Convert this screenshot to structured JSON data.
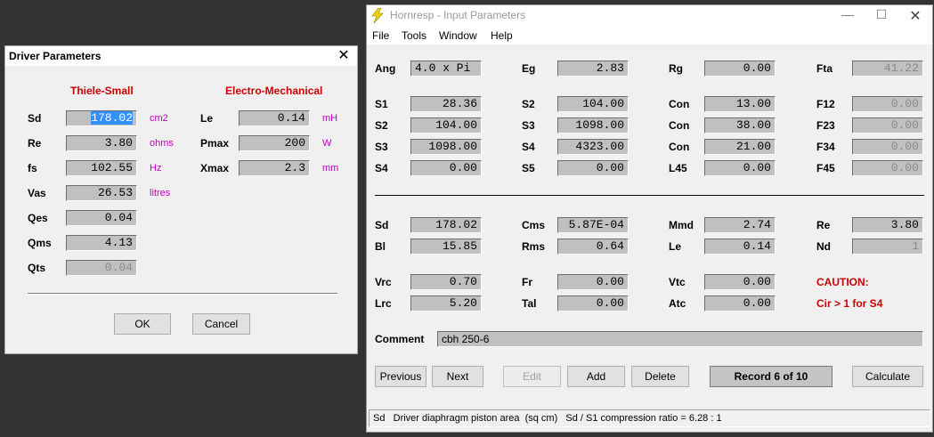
{
  "driver": {
    "title": "Driver Parameters",
    "close": "✕",
    "heading_ts": "Thiele-Small",
    "heading_em": "Electro-Mechanical",
    "ts": [
      {
        "label": "Sd",
        "value": "178.02",
        "unit": "cm2"
      },
      {
        "label": "Re",
        "value": "3.80",
        "unit": "ohms"
      },
      {
        "label": "fs",
        "value": "102.55",
        "unit": "Hz"
      },
      {
        "label": "Vas",
        "value": "26.53",
        "unit": "litres"
      },
      {
        "label": "Qes",
        "value": "0.04",
        "unit": ""
      },
      {
        "label": "Qms",
        "value": "4.13",
        "unit": ""
      },
      {
        "label": "Qts",
        "value": "0.04",
        "unit": ""
      }
    ],
    "em": [
      {
        "label": "Le",
        "value": "0.14",
        "unit": "mH"
      },
      {
        "label": "Pmax",
        "value": "200",
        "unit": "W"
      },
      {
        "label": "Xmax",
        "value": "2.3",
        "unit": "mm"
      }
    ],
    "ok": "OK",
    "cancel": "Cancel"
  },
  "input": {
    "title": "Hornresp - Input Parameters",
    "menu": [
      "File",
      "Tools",
      "Window",
      "Help"
    ],
    "ang": {
      "label": "Ang",
      "value": "4.0 x Pi"
    },
    "eg": {
      "label": "Eg",
      "value": "2.83"
    },
    "rg": {
      "label": "Rg",
      "value": "0.00"
    },
    "fta": {
      "label": "Fta",
      "value": "41.22"
    },
    "s1": {
      "label": "S1",
      "value": "28.36"
    },
    "s2a": {
      "label": "S2",
      "value": "104.00"
    },
    "con1": {
      "label": "Con",
      "value": "13.00"
    },
    "f12": {
      "label": "F12",
      "value": "0.00"
    },
    "s2b": {
      "label": "S2",
      "value": "104.00"
    },
    "s3a": {
      "label": "S3",
      "value": "1098.00"
    },
    "con2": {
      "label": "Con",
      "value": "38.00"
    },
    "f23": {
      "label": "F23",
      "value": "0.00"
    },
    "s3b": {
      "label": "S3",
      "value": "1098.00"
    },
    "s4a": {
      "label": "S4",
      "value": "4323.00"
    },
    "con3": {
      "label": "Con",
      "value": "21.00"
    },
    "f34": {
      "label": "F34",
      "value": "0.00"
    },
    "s4b": {
      "label": "S4",
      "value": "0.00"
    },
    "s5": {
      "label": "S5",
      "value": "0.00"
    },
    "l45": {
      "label": "L45",
      "value": "0.00"
    },
    "f45": {
      "label": "F45",
      "value": "0.00"
    },
    "sd": {
      "label": "Sd",
      "value": "178.02"
    },
    "cms": {
      "label": "Cms",
      "value": "5.87E-04"
    },
    "mmd": {
      "label": "Mmd",
      "value": "2.74"
    },
    "re": {
      "label": "Re",
      "value": "3.80"
    },
    "bl": {
      "label": "Bl",
      "value": "15.85"
    },
    "rms": {
      "label": "Rms",
      "value": "0.64"
    },
    "le": {
      "label": "Le",
      "value": "0.14"
    },
    "nd": {
      "label": "Nd",
      "value": "1"
    },
    "vrc": {
      "label": "Vrc",
      "value": "0.70"
    },
    "fr": {
      "label": "Fr",
      "value": "0.00"
    },
    "vtc": {
      "label": "Vtc",
      "value": "0.00"
    },
    "caution_title": "CAUTION:",
    "lrc": {
      "label": "Lrc",
      "value": "5.20"
    },
    "tal": {
      "label": "Tal",
      "value": "0.00"
    },
    "atc": {
      "label": "Atc",
      "value": "0.00"
    },
    "caution_text": "Cir > 1 for S4",
    "comment": {
      "label": "Comment",
      "value": "cbh 250-6"
    },
    "buttons": {
      "previous": "Previous",
      "next": "Next",
      "edit": "Edit",
      "add": "Add",
      "delete": "Delete",
      "record": "Record 6 of 10",
      "calculate": "Calculate"
    },
    "status": "Sd   Driver diaphragm piston area  (sq cm)   Sd / S1 compression ratio = 6.28 : 1"
  }
}
